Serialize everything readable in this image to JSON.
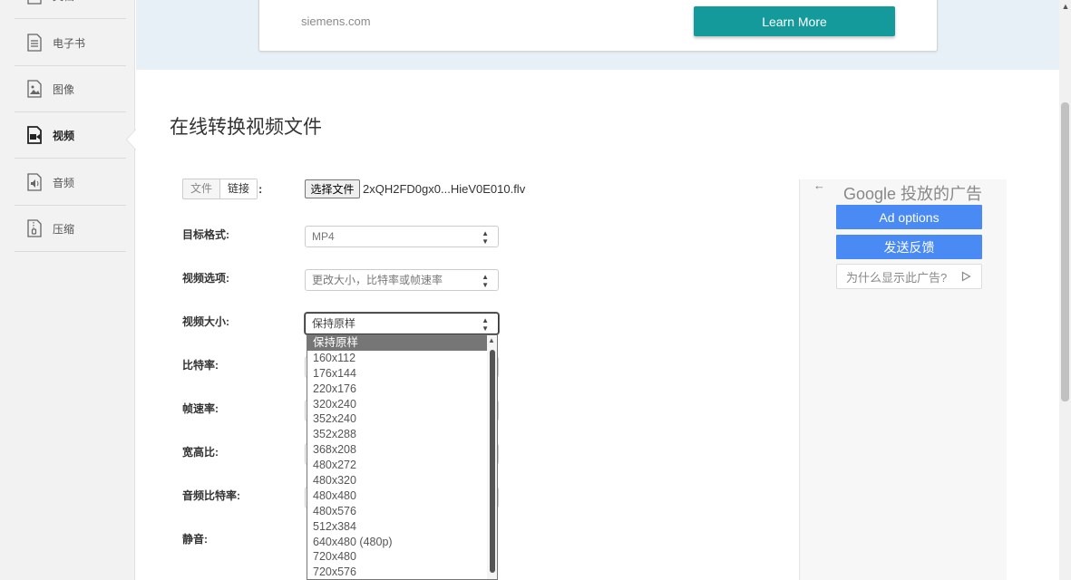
{
  "sidebar": {
    "items": [
      {
        "label": "文档",
        "icon": "document-icon"
      },
      {
        "label": "电子书",
        "icon": "ebook-icon"
      },
      {
        "label": "图像",
        "icon": "image-icon"
      },
      {
        "label": "视频",
        "icon": "video-icon",
        "active": true
      },
      {
        "label": "音频",
        "icon": "audio-icon"
      },
      {
        "label": "压缩",
        "icon": "archive-icon"
      }
    ]
  },
  "banner": {
    "domain": "siemens.com",
    "cta_label": "Learn More",
    "cta_color": "#159a9c"
  },
  "main": {
    "title": "在线转换视频文件",
    "source_tabs": [
      "文件",
      "链接"
    ],
    "source_colon": ":",
    "file_button_label": "选择文件",
    "file_name": "2xQH2FD0gx0...HieV0E010.flv",
    "fields": [
      {
        "label": "目标格式:",
        "value": "MP4"
      },
      {
        "label": "视频选项:",
        "value": "更改大小，比特率或帧速率"
      },
      {
        "label": "视频大小:",
        "value": "保持原样"
      },
      {
        "label": "比特率:",
        "value": ""
      },
      {
        "label": "帧速率:",
        "value": ""
      },
      {
        "label": "宽高比:",
        "value": ""
      },
      {
        "label": "音频比特率:",
        "value": ""
      },
      {
        "label": "静音:",
        "value": ""
      }
    ],
    "video_size_options": [
      "保持原样",
      "160x112",
      "176x144",
      "220x176",
      "320x240",
      "352x240",
      "352x288",
      "368x208",
      "480x272",
      "480x320",
      "480x480",
      "480x576",
      "512x384",
      "640x480 (480p)",
      "720x480",
      "720x576"
    ],
    "video_size_selected": "保持原样"
  },
  "ad": {
    "back_icon": "arrow-left-icon",
    "google_label": "Google 投放的广告",
    "options_label": "Ad options",
    "feedback_label": "发送反馈",
    "why_label": "为什么显示此广告?",
    "button_color": "#4a8af4"
  }
}
